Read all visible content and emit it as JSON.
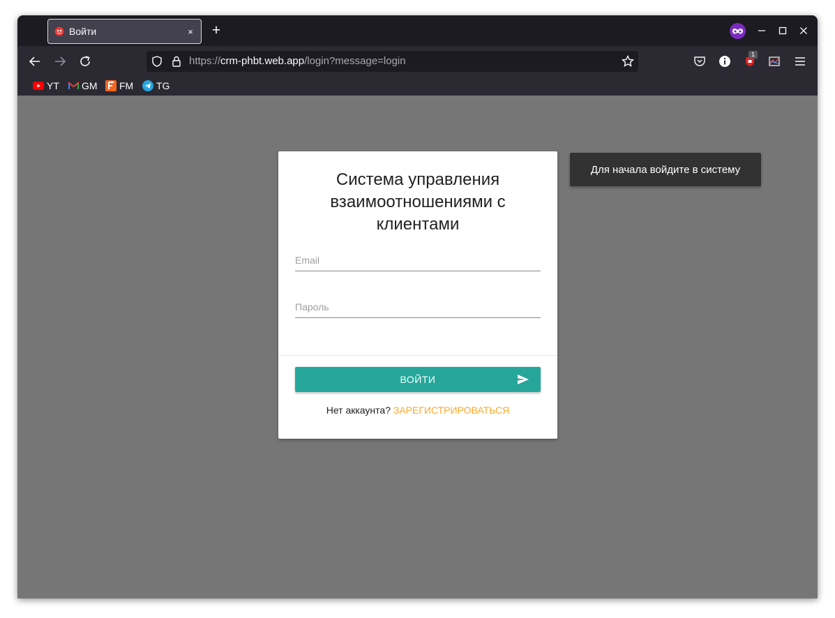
{
  "browser": {
    "tab": {
      "title": "Войти",
      "close_icon": "×"
    },
    "new_tab_icon": "+",
    "url": {
      "scheme": "https://",
      "host": "crm-phbt.web.app",
      "path": "/login?message=login"
    },
    "extension_badge": "1",
    "bookmarks": [
      {
        "label": "YT",
        "icon": "youtube-icon",
        "color": "#ff0000"
      },
      {
        "label": "GM",
        "icon": "gmail-icon",
        "color": "#ea4335"
      },
      {
        "label": "FM",
        "icon": "fm-icon",
        "color": "#f26522"
      },
      {
        "label": "TG",
        "icon": "telegram-icon",
        "color": "#2aa3df"
      }
    ]
  },
  "login": {
    "title": "Система управления взаимоотношениями с клиентами",
    "email_placeholder": "Email",
    "password_placeholder": "Пароль",
    "submit_label": "ВОЙТИ",
    "no_account_text": "Нет аккаунта?",
    "register_link": "ЗАРЕГИСТРИРОВАТЬСЯ"
  },
  "toast": {
    "message": "Для начала войдите в систему"
  },
  "colors": {
    "accent": "#26a69a",
    "link": "#ffa726",
    "page_background": "#767676",
    "toast_background": "#323232"
  }
}
